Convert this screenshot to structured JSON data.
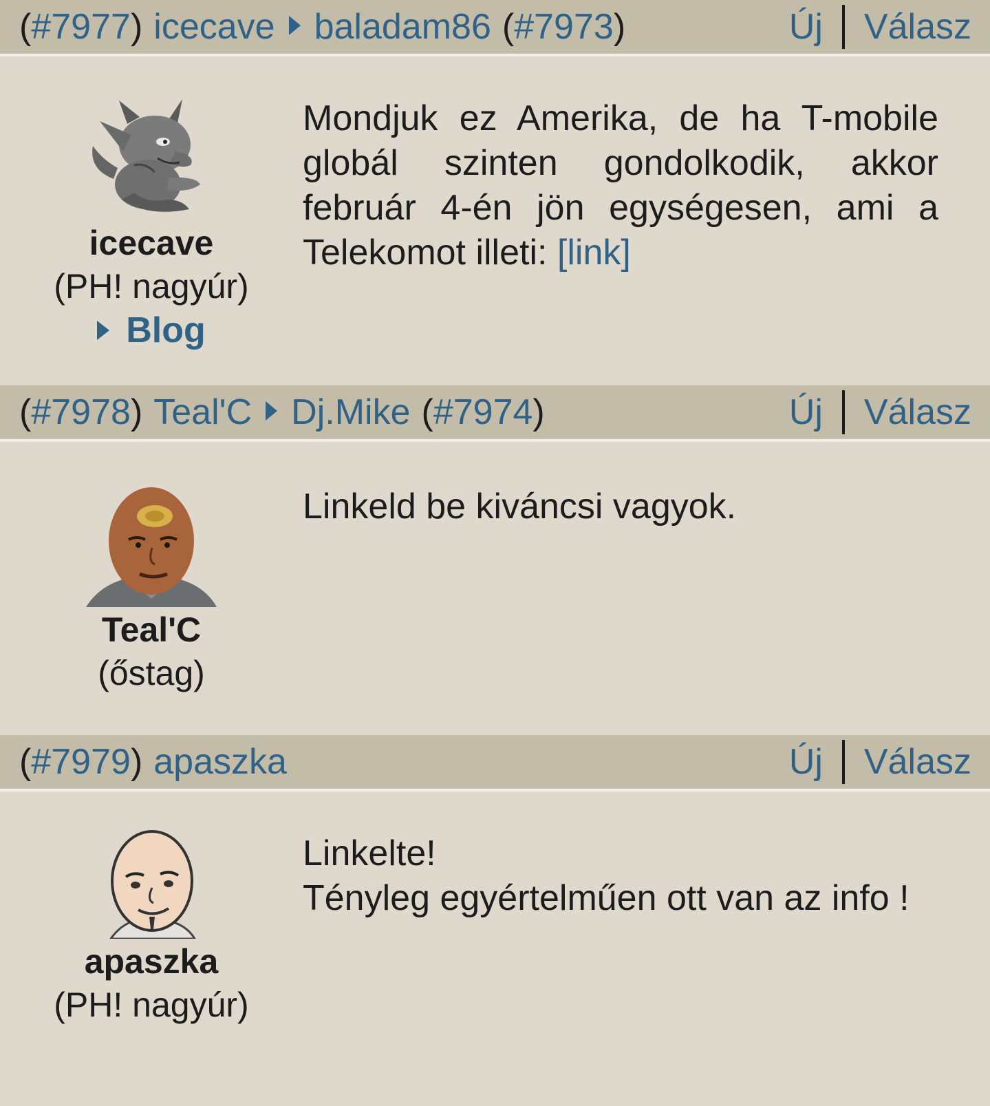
{
  "posts": [
    {
      "number": "#7977",
      "author": "icecave",
      "reply_to_user": "baladam86",
      "reply_to_number": "#7973",
      "action_new": "Új",
      "action_reply": "Válasz",
      "author_rank": "(PH! nagyúr)",
      "blog_label": "Blog",
      "text": "Mondjuk ez Amerika, de ha T-mobile globál szinten gondolkodik, akkor február 4-én jön egységesen, ami a Telekomot illeti:",
      "link_text": "[link]",
      "avatar_icon": "gargoyle-avatar"
    },
    {
      "number": "#7978",
      "author": "Teal'C",
      "reply_to_user": "Dj.Mike",
      "reply_to_number": "#7974",
      "action_new": "Új",
      "action_reply": "Válasz",
      "author_rank": "(őstag)",
      "text": "Linkeld be kiváncsi vagyok.",
      "avatar_icon": "tealc-avatar"
    },
    {
      "number": "#7979",
      "author": "apaszka",
      "action_new": "Új",
      "action_reply": "Válasz",
      "author_rank": "(PH! nagyúr)",
      "text_line1": "Linkelte!",
      "text_line2": "Tényleg egyértelműen ott van az info !",
      "avatar_icon": "bald-man-avatar"
    }
  ],
  "colors": {
    "link": "#2f6286",
    "header_bg": "#c3bca9",
    "body_bg": "#dfd9cd"
  }
}
